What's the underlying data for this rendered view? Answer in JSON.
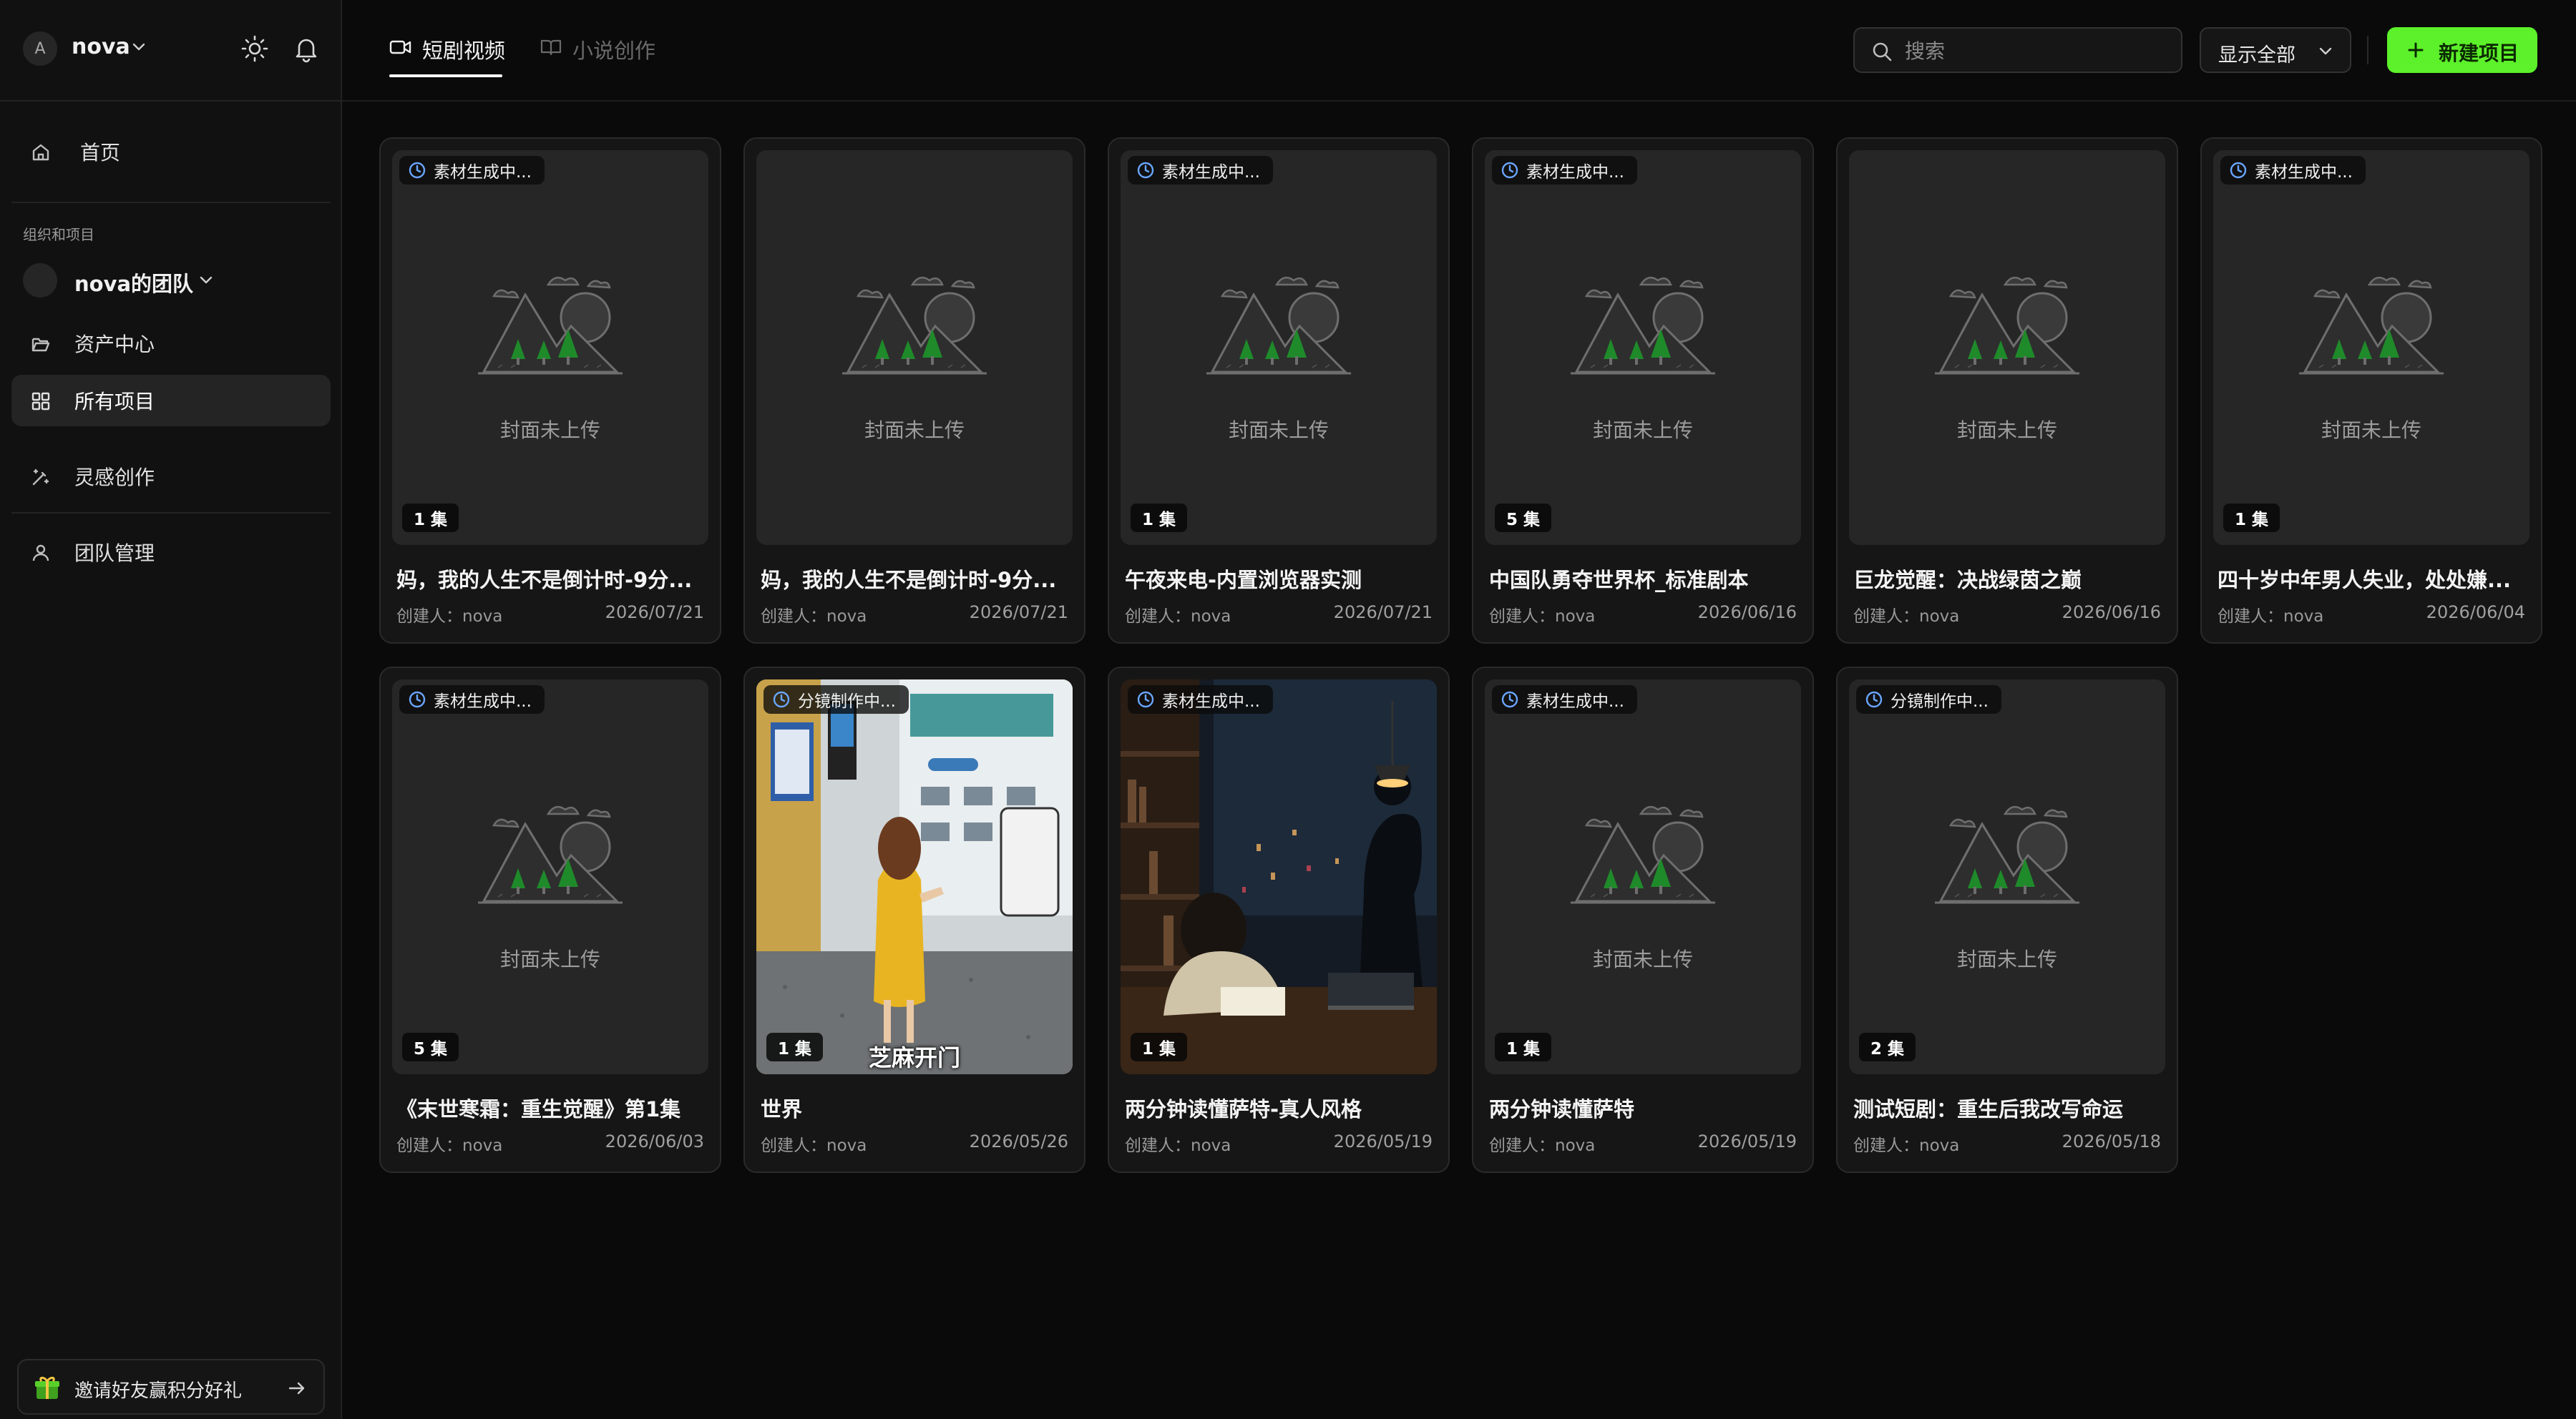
{
  "user": {
    "avatar_letter": "A",
    "name": "nova"
  },
  "sidebar": {
    "home": "首页",
    "group_title": "组织和项目",
    "team_name": "nova的团队",
    "assets": "资产中心",
    "all_projects": "所有项目",
    "inspiration": "灵感创作",
    "team_manage": "团队管理",
    "invite": "邀请好友赢积分好礼"
  },
  "header": {
    "tabs": [
      {
        "label": "短剧视频",
        "active": true
      },
      {
        "label": "小说创作",
        "active": false
      }
    ],
    "search_placeholder": "搜索",
    "filter_value": "显示全部",
    "new_button": "新建项目"
  },
  "placeholder_text": "封面未上传",
  "creator_prefix": "创建人：",
  "projects": [
    {
      "title": "妈，我的人生不是倒计时-9分...",
      "creator": "nova",
      "date": "2026/07/21",
      "status": "素材生成中...",
      "episodes": "1 集",
      "cover": "placeholder"
    },
    {
      "title": "妈，我的人生不是倒计时-9分...",
      "creator": "nova",
      "date": "2026/07/21",
      "status": "",
      "episodes": "",
      "cover": "placeholder"
    },
    {
      "title": "午夜来电-内置浏览器实测",
      "creator": "nova",
      "date": "2026/07/21",
      "status": "素材生成中...",
      "episodes": "1 集",
      "cover": "placeholder"
    },
    {
      "title": "中国队勇夺世界杯_标准剧本",
      "creator": "nova",
      "date": "2026/06/16",
      "status": "素材生成中...",
      "episodes": "5 集",
      "cover": "placeholder"
    },
    {
      "title": "巨龙觉醒：决战绿茵之巅",
      "creator": "nova",
      "date": "2026/06/16",
      "status": "",
      "episodes": "",
      "cover": "placeholder"
    },
    {
      "title": "四十岁中年男人失业，处处嫌...",
      "creator": "nova",
      "date": "2026/06/04",
      "status": "素材生成中...",
      "episodes": "1 集",
      "cover": "placeholder"
    },
    {
      "title": "《末世寒霜：重生觉醒》第1集",
      "creator": "nova",
      "date": "2026/06/03",
      "status": "素材生成中...",
      "episodes": "5 集",
      "cover": "placeholder"
    },
    {
      "title": "世界",
      "creator": "nova",
      "date": "2026/05/26",
      "status": "分镜制作中...",
      "episodes": "1 集",
      "cover": "elevator",
      "caption": "芝麻开门"
    },
    {
      "title": "两分钟读懂萨特-真人风格",
      "creator": "nova",
      "date": "2026/05/19",
      "status": "素材生成中...",
      "episodes": "1 集",
      "cover": "night"
    },
    {
      "title": "两分钟读懂萨特",
      "creator": "nova",
      "date": "2026/05/19",
      "status": "素材生成中...",
      "episodes": "1 集",
      "cover": "placeholder"
    },
    {
      "title": "测试短剧：重生后我改写命运",
      "creator": "nova",
      "date": "2026/05/18",
      "status": "分镜制作中...",
      "episodes": "2 集",
      "cover": "placeholder"
    }
  ],
  "colors": {
    "accent": "#5cf12a",
    "background": "#0a0a0a",
    "card": "#161616"
  },
  "icons": {
    "status": "clock-icon",
    "new": "plus-icon",
    "search": "search-icon",
    "theme": "sun-icon",
    "notify": "bell-icon",
    "invite": "gift-icon",
    "invite_arrow": "arrow-right-icon"
  }
}
